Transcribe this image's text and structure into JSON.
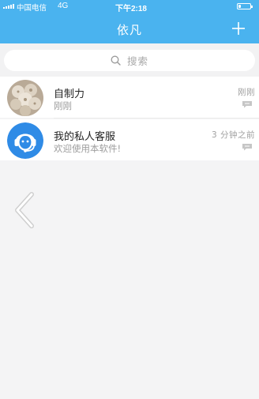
{
  "status_bar": {
    "carrier": "中国电信",
    "network": "4G",
    "time": "下午2:18",
    "battery_level": 0.2
  },
  "header": {
    "title": "依凡",
    "add_icon": "plus-icon"
  },
  "search": {
    "placeholder": "搜索",
    "icon": "search-icon"
  },
  "conversations": [
    {
      "name": "自制力",
      "preview": "刚刚",
      "time": "刚刚",
      "avatar": "photo-avatar",
      "status_icon": "message-bubble-icon"
    },
    {
      "name": "我的私人客服",
      "preview": "欢迎使用本软件!",
      "time": "3 分钟之前",
      "avatar": "headset-support-icon",
      "status_icon": "message-bubble-icon"
    }
  ],
  "overlay": {
    "back_icon": "chevron-left-icon"
  },
  "colors": {
    "brand": "#4ab3ef",
    "support_avatar": "#2f8be6",
    "background": "#f4f4f5"
  }
}
